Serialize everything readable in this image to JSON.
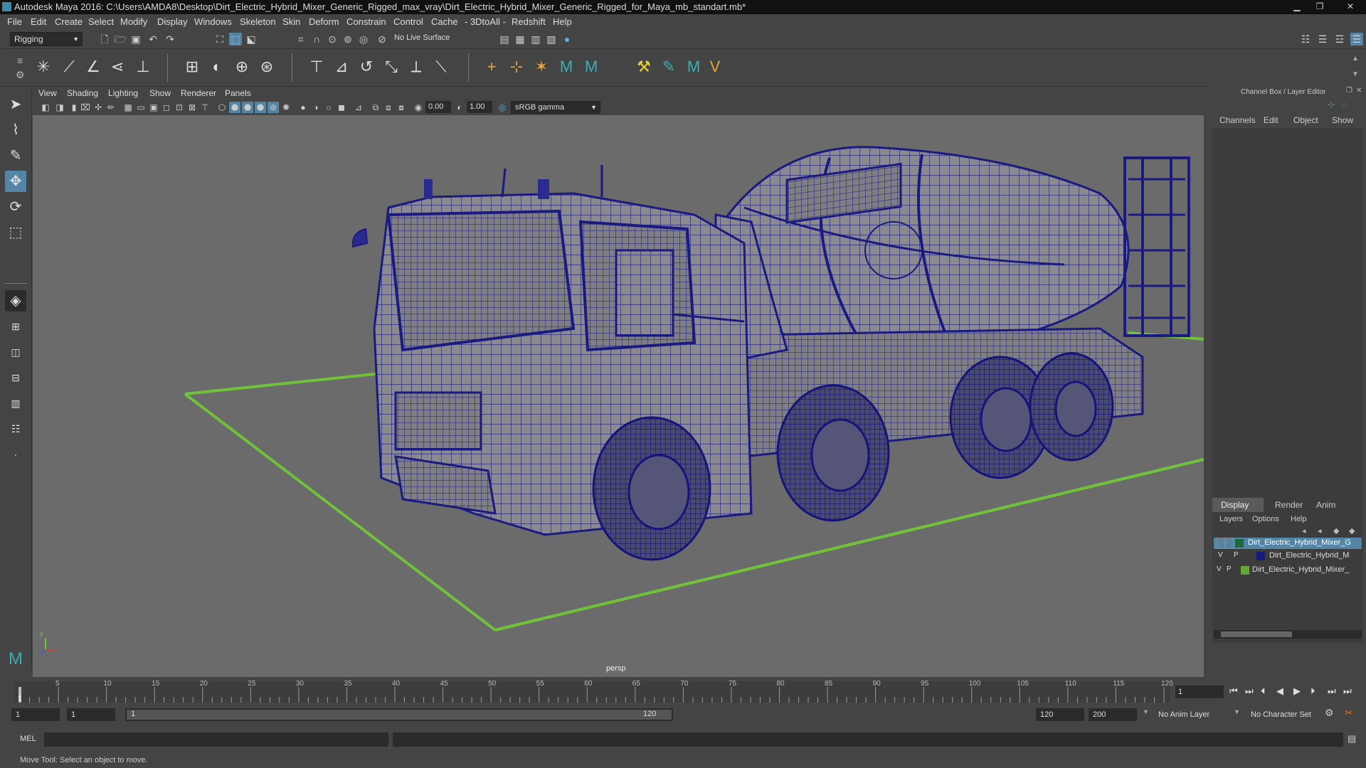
{
  "window": {
    "title": "Autodesk Maya 2016: C:\\Users\\AMDA8\\Desktop\\Dirt_Electric_Hybrid_Mixer_Generic_Rigged_max_vray\\Dirt_Electric_Hybrid_Mixer_Generic_Rigged_for_Maya_mb_standart.mb*",
    "minimize": "▁",
    "maximize": "❐",
    "close": "✕"
  },
  "menubar": [
    "File",
    "Edit",
    "Create",
    "Select",
    "Modify",
    "Display",
    "Windows",
    "Skeleton",
    "Skin",
    "Deform",
    "Constrain",
    "Control",
    "Cache",
    "- 3DtoAll -",
    "Redshift",
    "Help"
  ],
  "status_line": {
    "menu_set": "Rigging",
    "live_surface": "No Live Surface"
  },
  "viewport_menu": [
    "View",
    "Shading",
    "Lighting",
    "Show",
    "Renderer",
    "Panels"
  ],
  "viewport_toolbar": {
    "exposure": "0.00",
    "gamma": "1.00",
    "color_space": "sRGB gamma"
  },
  "viewport": {
    "camera_label": "persp",
    "axis_y": "y",
    "axis_x": "x"
  },
  "channel_box": {
    "title": "Channel Box / Layer Editor",
    "menu": [
      "Channels",
      "Edit",
      "Object",
      "Show"
    ]
  },
  "layer_editor": {
    "tabs": [
      "Display",
      "Render",
      "Anim"
    ],
    "menu": [
      "Layers",
      "Options",
      "Help"
    ],
    "layers": [
      {
        "v": "",
        "p": "",
        "name": "Dirt_Electric_Hybrid_Mixer_G",
        "color": "#1f6a3a",
        "selected": true
      },
      {
        "v": "V",
        "p": "P",
        "name": "Dirt_Electric_Hybrid_M",
        "color": "#161a7a",
        "selected": false
      },
      {
        "v": "V",
        "p": "P",
        "name": "Dirt_Electric_Hybrid_Mixer_",
        "color": "#5fa832",
        "selected": false
      }
    ]
  },
  "time_slider": {
    "ticks": [
      "5",
      "10",
      "15",
      "20",
      "25",
      "30",
      "35",
      "40",
      "45",
      "50",
      "55",
      "60",
      "65",
      "70",
      "75",
      "80",
      "85",
      "90",
      "95",
      "100",
      "105",
      "110",
      "115",
      "120"
    ],
    "first": "1",
    "current_frame": "1"
  },
  "range_slider": {
    "start": "1",
    "playback_start": "1",
    "range_handle_start": "1",
    "range_handle_end": "120",
    "playback_end": "120",
    "end": "200",
    "anim_layer": "No Anim Layer",
    "character_set": "No Character Set"
  },
  "command_line": {
    "language": "MEL"
  },
  "help_line": {
    "text": "Move Tool: Select an object to move."
  },
  "colors": {
    "wire": "#1a1a80",
    "ground": "#6fc23a",
    "viewport_bg": "#6b6b6b",
    "accent": "#5285a6"
  }
}
